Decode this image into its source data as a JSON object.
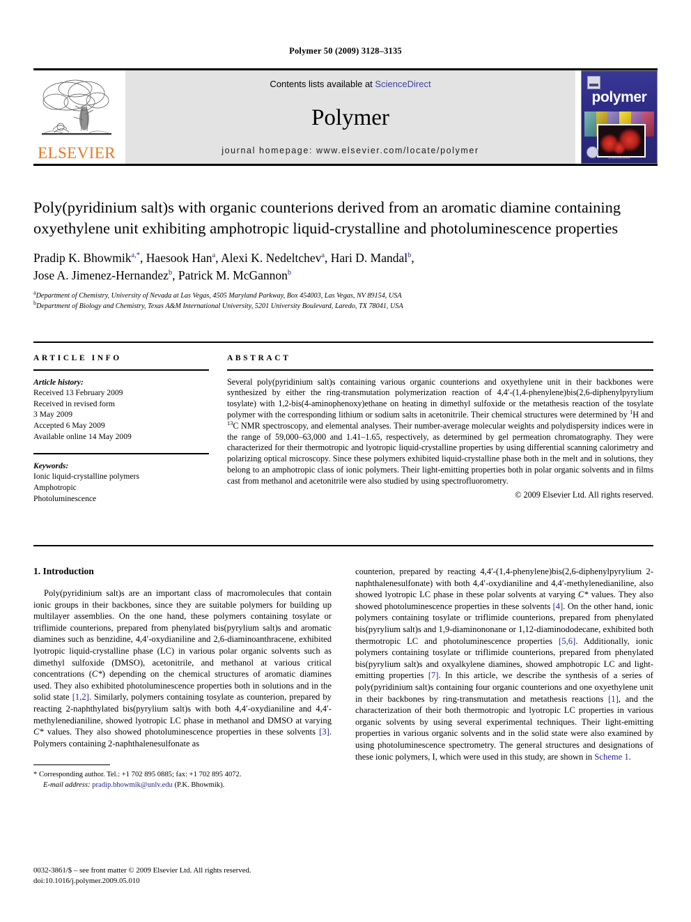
{
  "running_head": "Polymer 50 (2009) 3128–3135",
  "masthead": {
    "publisher_name": "ELSEVIER",
    "contents_prefix": "Contents lists available at ",
    "contents_link": "ScienceDirect",
    "journal_name": "Polymer",
    "homepage": "journal homepage: www.elsevier.com/locate/polymer",
    "cover_title": "polymer",
    "cover_footer": "ScienceDirect",
    "link_color": "#3b3f9c",
    "brand_color": "#E87722"
  },
  "article": {
    "title": "Poly(pyridinium salt)s with organic counterions derived from an aromatic diamine containing oxyethylene unit exhibiting amphotropic liquid-crystalline and photoluminescence properties",
    "authors": [
      {
        "name": "Pradip K. Bhowmik",
        "marks": "a,*"
      },
      {
        "name": "Haesook Han",
        "marks": "a"
      },
      {
        "name": "Alexi K. Nedeltchev",
        "marks": "a"
      },
      {
        "name": "Hari D. Mandal",
        "marks": "b"
      },
      {
        "name": "Jose A. Jimenez-Hernandez",
        "marks": "b"
      },
      {
        "name": "Patrick M. McGannon",
        "marks": "b"
      }
    ],
    "affiliations": [
      {
        "mark": "a",
        "text": "Department of Chemistry, University of Nevada at Las Vegas, 4505 Maryland Parkway, Box 454003, Las Vegas, NV 89154, USA"
      },
      {
        "mark": "b",
        "text": "Department of Biology and Chemistry, Texas A&M International University, 5201 University Boulevard, Laredo, TX 78041, USA"
      }
    ]
  },
  "info": {
    "label": "ARTICLE INFO",
    "history_label": "Article history:",
    "history": [
      "Received 13 February 2009",
      "Received in revised form",
      "3 May 2009",
      "Accepted 6 May 2009",
      "Available online 14 May 2009"
    ],
    "keywords_label": "Keywords:",
    "keywords": [
      "Ionic liquid-crystalline polymers",
      "Amphotropic",
      "Photoluminescence"
    ]
  },
  "abstract": {
    "label": "ABSTRACT",
    "part1": "Several poly(pyridinium salt)s containing various organic counterions and oxyethylene unit in their backbones were synthesized by either the ring-transmutation polymerization reaction of 4,4′-(1,4-phenylene)bis(2,6-diphenylpyrylium tosylate) with 1,2-bis(4-aminophenoxy)ethane on heating in dimethyl sulfoxide or the metathesis reaction of the tosylate polymer with the corresponding lithium or sodium salts in acetonitrile. Their chemical structures were determined by ",
    "nmr_h_sup": "1",
    "nmr_h": "H and ",
    "nmr_c_sup": "13",
    "nmr_c": "C NMR spectroscopy,",
    "part2": " and elemental analyses. Their number-average molecular weights and polydispersity indices were in the range of 59,000–63,000 and 1.41–1.65, respectively, as determined by gel permeation chromatography. They were characterized for their thermotropic and lyotropic liquid-crystalline properties by using differential scanning calorimetry and polarizing optical microscopy. Since these polymers exhibited liquid-crystalline phase both in the melt and in solutions, they belong to an amphotropic class of ionic polymers. Their light-emitting properties both in polar organic solvents and in films cast from methanol and acetonitrile were also studied by using spectrofluorometry.",
    "copyright": "© 2009 Elsevier Ltd. All rights reserved."
  },
  "introduction": {
    "heading": "1. Introduction",
    "left_p1_a": "Poly(pyridinium salt)s are an important class of macromolecules that contain ionic groups in their backbones, since they are suitable polymers for building up multilayer assemblies. On the one hand, these polymers containing tosylate or triflimide counterions, prepared from phenylated bis(pyrylium salt)s and aromatic diamines such as benzidine, 4,4′-oxydianiline and 2,6-diaminoanthracene, exhibited lyotropic liquid-crystalline phase (LC) in various polar organic solvents such as dimethyl sulfoxide (DMSO), acetonitrile, and methanol at various critical concentrations (",
    "cstar_1": "C*",
    "left_p1_b": ") depending on the chemical structures of aromatic diamines used. They also exhibited photoluminescence properties both in solutions and in the solid state ",
    "ref_12": "[1,2]",
    "left_p1_c": ". Similarly, polymers containing tosylate as counterion, prepared by reacting 2-naphthylated bis(pyrylium salt)s with both 4,4′-oxydianiline and 4,4′-methylenedianiline, showed lyotropic LC phase in methanol and DMSO at varying ",
    "cstar_2": "C*",
    "left_p1_d": " values. They also showed photoluminescence properties in these solvents ",
    "ref_3": "[3]",
    "left_p1_e": ". Polymers containing 2-naphthalenesulfonate as",
    "right_p1_a": "counterion, prepared by reacting 4,4′-(1,4-phenylene)bis(2,6-diphenylpyrylium 2-naphthalenesulfonate) with both 4,4′-oxydianiline and 4,4′-methylenedianiline, also showed lyotropic LC phase in these polar solvents at varying ",
    "cstar_3": "C*",
    "right_p1_b": " values. They also showed photoluminescence properties in these solvents ",
    "ref_4": "[4]",
    "right_p1_c": ". On the other hand, ionic polymers containing tosylate or triflimide counterions, prepared from phenylated bis(pyrylium salt)s and 1,9-diaminononane or 1,12-diaminododecane, exhibited both thermotropic LC and photoluminescence properties ",
    "ref_56": "[5,6]",
    "right_p1_d": ". Additionally, ionic polymers containing tosylate or triflimide counterions, prepared from phenylated bis(pyrylium salt)s and oxyalkylene diamines, showed amphotropic LC and light-emitting properties ",
    "ref_7": "[7]",
    "right_p1_e": ". In this article, we describe the synthesis of a series of poly(pyridinium salt)s containing four organic counterions and one oxyethylene unit in their backbones by ring-transmutation and metathesis reactions ",
    "ref_1": "[1]",
    "right_p1_f": ", and the characterization of their both thermotropic and lyotropic LC properties in various organic solvents by using several experimental techniques. Their light-emitting properties in various organic solvents and in the solid state were also examined by using photoluminescence spectrometry. The general structures and designations of these ionic polymers, I, which were used in this study, are shown in ",
    "scheme_link": "Scheme 1",
    "right_p1_g": "."
  },
  "footnote": {
    "star_line": "* Corresponding author. Tel.: +1 702 895 0885; fax: +1 702 895 4072.",
    "email_label": "E-mail address:",
    "email": "pradip.bhowmik@unlv.edu",
    "email_suffix": " (P.K. Bhowmik)."
  },
  "imprint": {
    "line1": "0032-3861/$ – see front matter © 2009 Elsevier Ltd. All rights reserved.",
    "line2": "doi:10.1016/j.polymer.2009.05.010"
  }
}
